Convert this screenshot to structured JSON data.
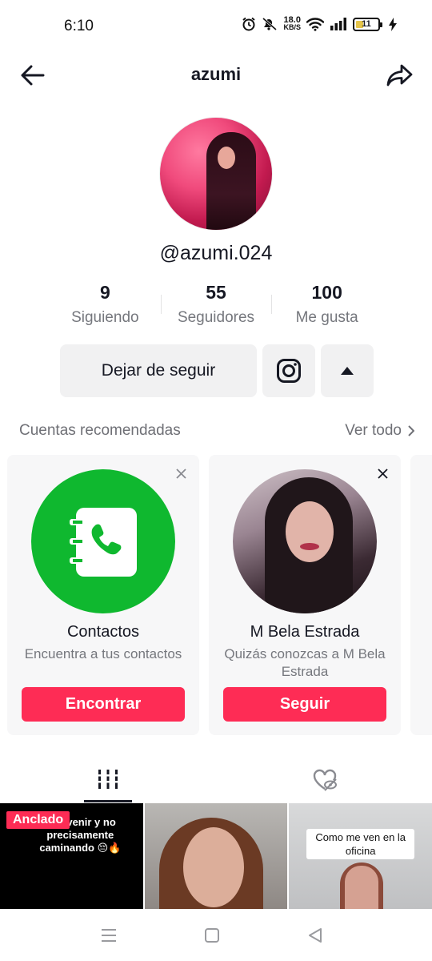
{
  "status_bar": {
    "time": "6:10",
    "net_speed_value": "18.0",
    "net_speed_unit": "KB/S",
    "battery_level": "11",
    "icons": [
      "alarm-icon",
      "mute-icon",
      "wifi-icon",
      "signal-icon",
      "battery-icon",
      "charging-icon"
    ]
  },
  "header": {
    "title": "azumi",
    "back_icon": "arrow-left-icon",
    "share_icon": "share-icon"
  },
  "profile": {
    "handle": "@azumi.024",
    "stats": [
      {
        "value": "9",
        "label": "Siguiendo"
      },
      {
        "value": "55",
        "label": "Seguidores"
      },
      {
        "value": "100",
        "label": "Me gusta"
      }
    ],
    "unfollow_label": "Dejar de seguir"
  },
  "recommended": {
    "title": "Cuentas recomendadas",
    "see_all": "Ver todo",
    "cards": [
      {
        "name": "Contactos",
        "subtitle": "Encuentra a tus contactos",
        "button": "Encontrar"
      },
      {
        "name": "M Bela Estrada",
        "subtitle": "Quizás conozcas a M Bela Estrada",
        "button": "Seguir"
      }
    ]
  },
  "tabs": {
    "videos_icon": "grid-icon",
    "liked_icon": "liked-hidden-icon"
  },
  "grid": {
    "pinned_label": "Anclado",
    "thumb1_caption": "erte venir y no precisamente caminando 😔🔥",
    "thumb3_caption": "Como me ven en la oficina"
  },
  "colors": {
    "accent": "#fe2c55",
    "contacts_green": "#0fb82f",
    "button_gray": "#f1f1f2"
  }
}
